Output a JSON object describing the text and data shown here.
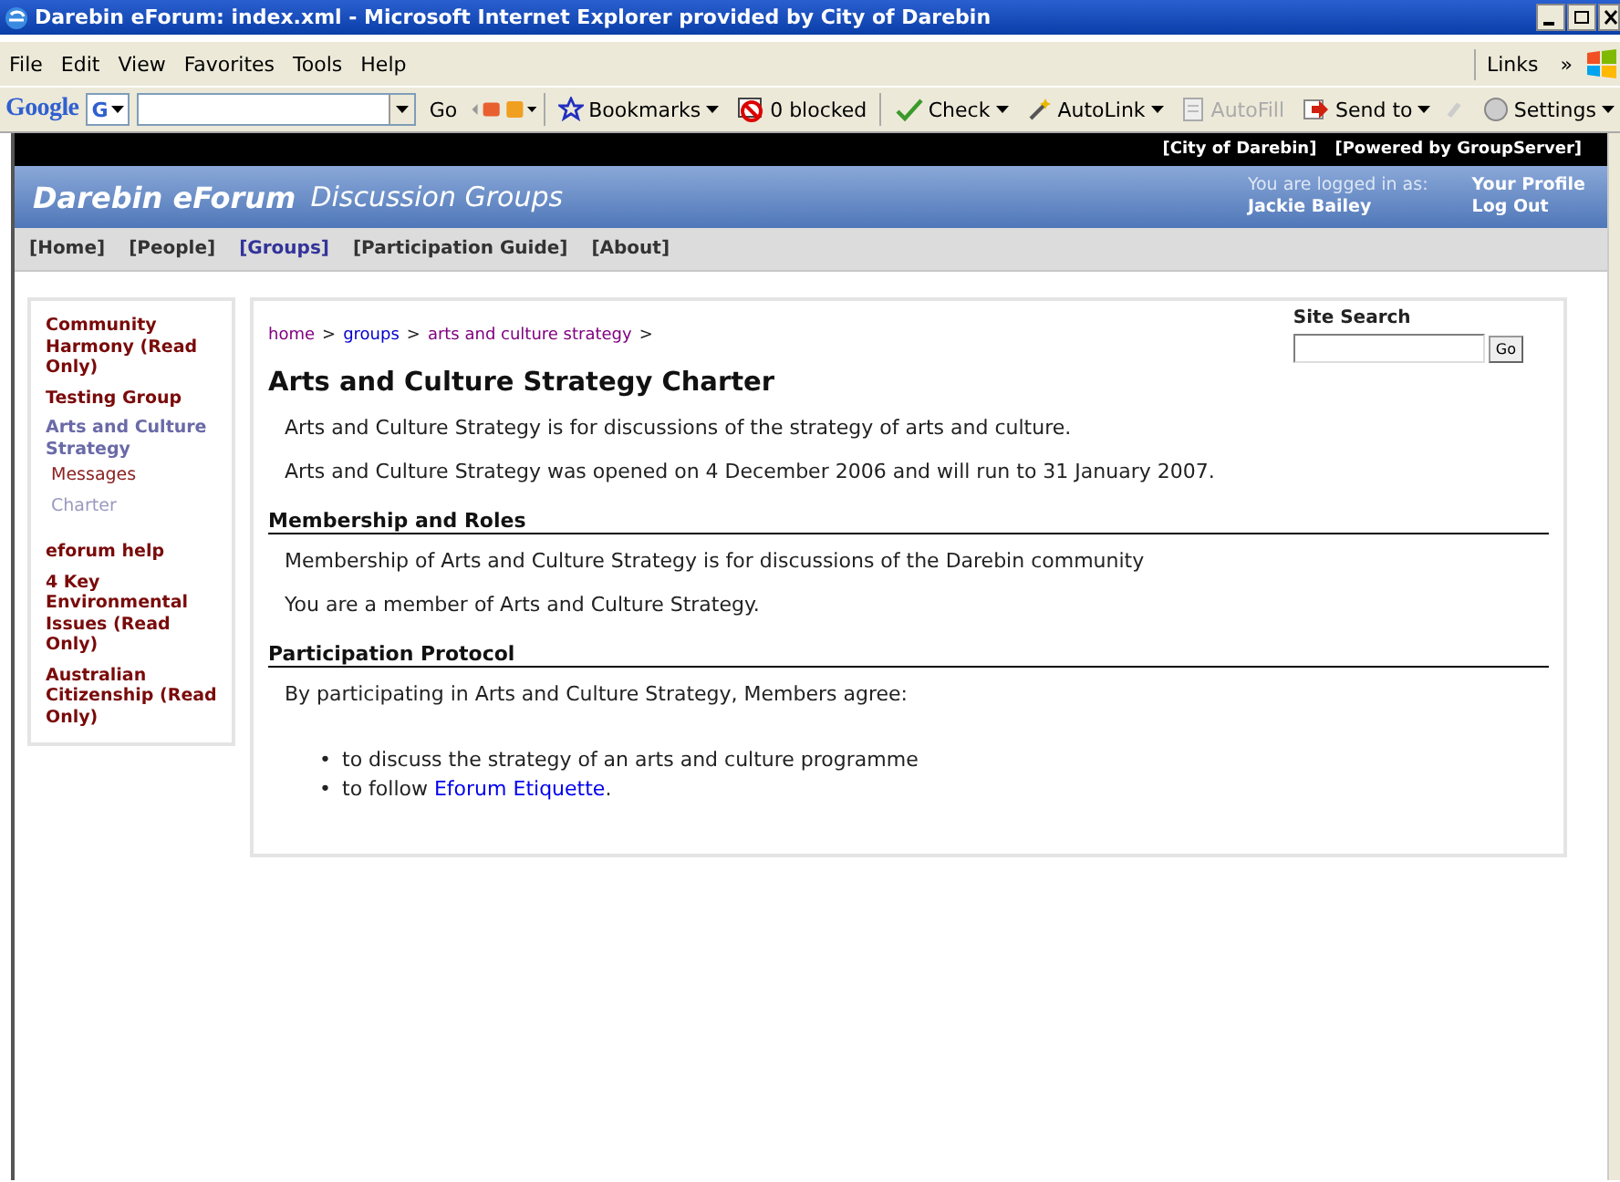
{
  "window": {
    "title": "Darebin eForum: index.xml - Microsoft Internet Explorer provided by City of Darebin"
  },
  "menu_bar": {
    "items": [
      "File",
      "Edit",
      "View",
      "Favorites",
      "Tools",
      "Help"
    ],
    "links_label": "Links",
    "chevron": "»"
  },
  "toolbar": {
    "logo": "Google",
    "engine": "G",
    "go": "Go",
    "buttons": [
      {
        "kind": "bookmarks",
        "label": "Bookmarks",
        "dropdown": true,
        "disabled": false
      },
      {
        "kind": "blocker",
        "label": "0 blocked",
        "dropdown": false,
        "disabled": false
      },
      {
        "kind": "spell",
        "label": "Check",
        "dropdown": true,
        "disabled": false
      },
      {
        "kind": "autolink",
        "label": "AutoLink",
        "dropdown": true,
        "disabled": false
      },
      {
        "kind": "autofill",
        "label": "AutoFill",
        "dropdown": false,
        "disabled": true
      },
      {
        "kind": "sendto",
        "label": "Send to",
        "dropdown": true,
        "disabled": false
      }
    ],
    "settings": "Settings"
  },
  "header": {
    "top_links": [
      "[City of Darebin]",
      "[Powered by GroupServer]"
    ],
    "site_name": "Darebin eForum",
    "tagline": "Discussion Groups",
    "login_label": "You are logged in as:",
    "user": "Jackie Bailey",
    "account_links": [
      "Your Profile",
      "Log Out"
    ]
  },
  "nav": [
    {
      "label": "[Home]",
      "selected": false
    },
    {
      "label": "[People]",
      "selected": false
    },
    {
      "label": "[Groups]",
      "selected": true
    },
    {
      "label": "[Participation Guide]",
      "selected": false
    },
    {
      "label": "[About]",
      "selected": false
    }
  ],
  "sidebar": {
    "groups": [
      {
        "items": [
          {
            "label": "Community Harmony (Read Only)",
            "selected": false
          },
          {
            "label": "Testing Group",
            "selected": false
          },
          {
            "label": "Arts and Culture Strategy",
            "selected": true,
            "children": [
              {
                "label": "Messages",
                "selected": false
              },
              {
                "label": "Charter",
                "selected": true
              }
            ]
          }
        ]
      },
      {
        "items": [
          {
            "label": "eforum help",
            "selected": false
          },
          {
            "label": "4 Key Environmental Issues (Read Only)",
            "selected": false
          },
          {
            "label": "Australian Citizenship (Read Only)",
            "selected": false
          }
        ]
      }
    ]
  },
  "breadcrumb": {
    "links": [
      {
        "label": "home",
        "visited": true
      },
      {
        "label": "groups",
        "visited": false
      },
      {
        "label": "arts and culture strategy",
        "visited": true
      }
    ],
    "separator": ">"
  },
  "search": {
    "label": "Site Search",
    "button": "Go"
  },
  "charter": {
    "title": "Arts and Culture Strategy Charter",
    "paragraphs": [
      "Arts and Culture Strategy is for discussions of the strategy of arts and culture.",
      "Arts and Culture Strategy was opened on 4 December 2006 and will run to 31 January 2007."
    ],
    "sections": [
      {
        "heading": "Membership and Roles",
        "paragraphs": [
          "Membership of Arts and Culture Strategy is for discussions of the Darebin community",
          "You are a member of Arts and Culture Strategy."
        ]
      },
      {
        "heading": "Participation Protocol",
        "paragraphs": [
          "By participating in Arts and Culture Strategy, Members agree:"
        ],
        "bullets": [
          {
            "marker": "•",
            "text": "to discuss the strategy of an arts and culture programme"
          },
          {
            "marker": "•",
            "text": "to follow ",
            "link": "Eforum Etiquette",
            "after": "."
          }
        ]
      }
    ]
  }
}
